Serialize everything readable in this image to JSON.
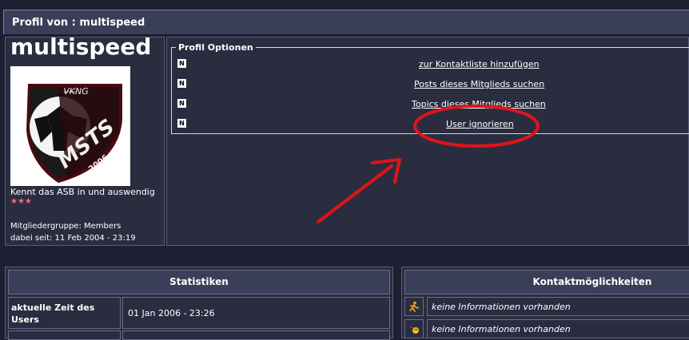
{
  "header": {
    "title": "Profil von : multispeed"
  },
  "profile": {
    "username": "multispeed",
    "avatar_text_top": "V̶K̶NG",
    "avatar_text_main": "MSTS",
    "avatar_text_sub": "2006",
    "rank": "Kennt das ASB in und auswendig",
    "stars": "★★★",
    "group": "Mitgliedergruppe: Members",
    "since": "dabei seit: 11 Feb 2004 - 23:19"
  },
  "options": {
    "legend": "Profil Optionen",
    "icon_letter": "N",
    "items": [
      {
        "label": "zur Kontaktliste hinzufügen"
      },
      {
        "label": "Posts dieses Mitglieds suchen"
      },
      {
        "label": "Topics dieses Mitglieds suchen"
      },
      {
        "label": "User ignorieren"
      }
    ]
  },
  "annotation": {
    "color": "#e0141a"
  },
  "stats": {
    "title": "Statistiken",
    "rows": [
      {
        "label": "aktuelle Zeit des Users",
        "value": "01 Jan 2006 - 23:26"
      }
    ]
  },
  "contacts": {
    "title": "Kontaktmöglichkeiten",
    "items": [
      {
        "icon": "aim-running-man-icon",
        "text": "keine Informationen vorhanden"
      },
      {
        "icon": "msn-butterfly-icon",
        "text": "keine Informationen vorhanden"
      }
    ]
  }
}
